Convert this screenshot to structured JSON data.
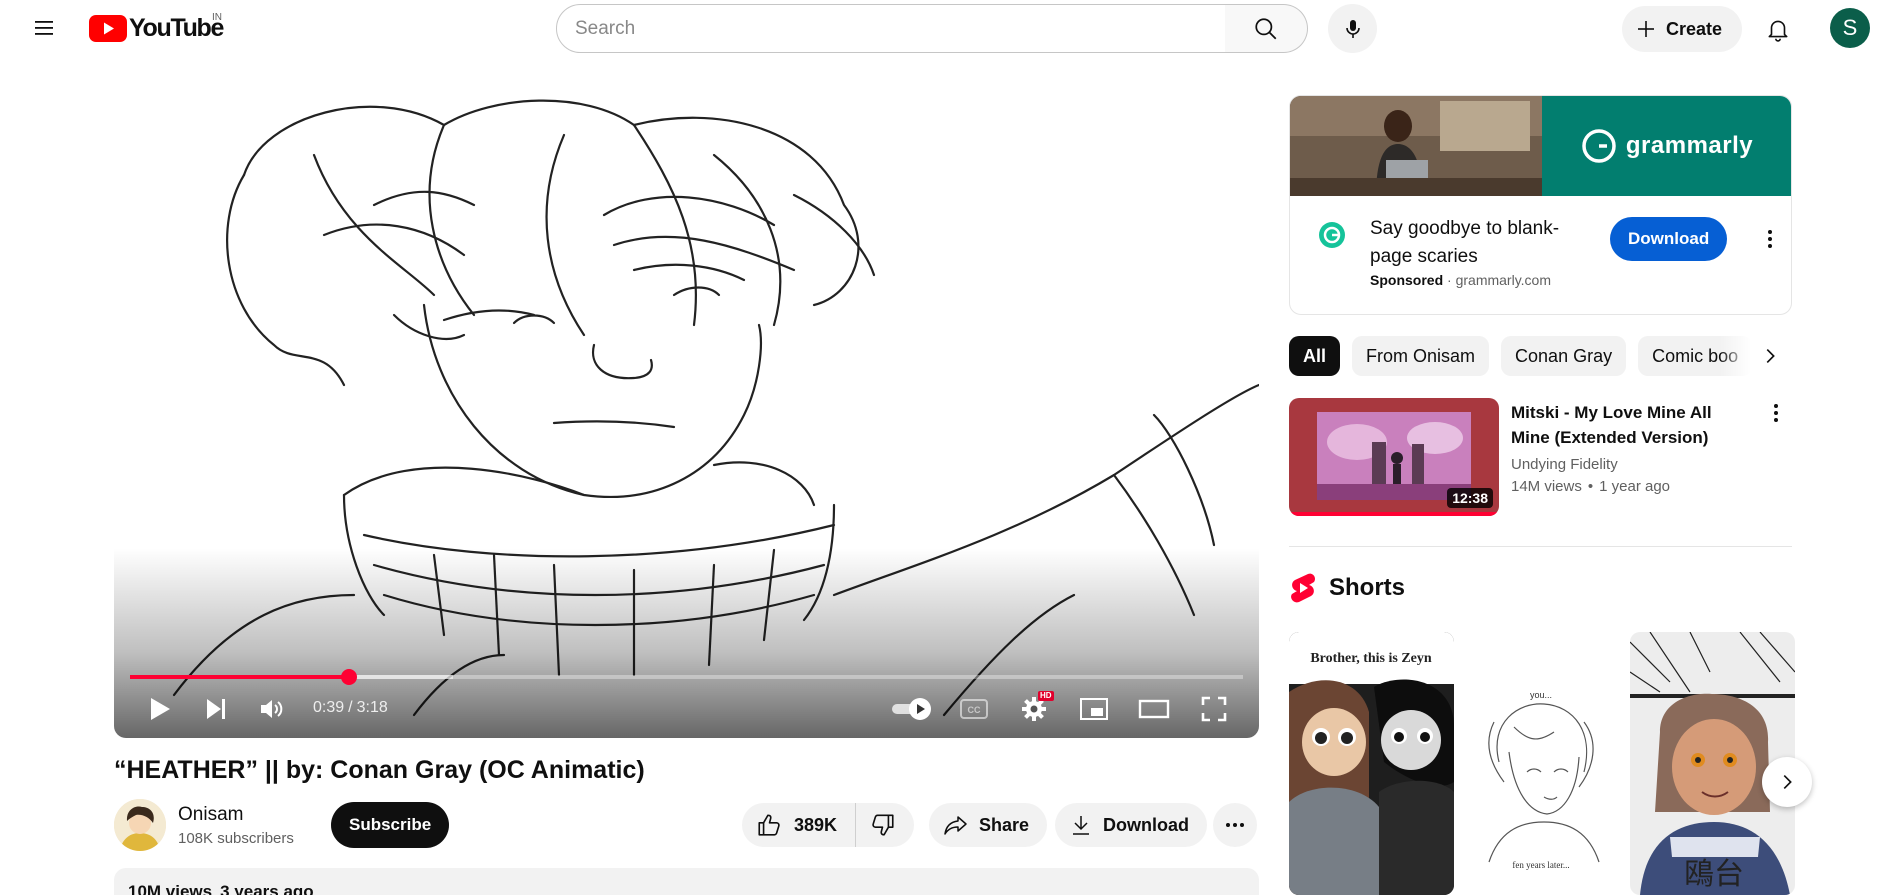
{
  "header": {
    "logo_text": "YouTube",
    "country_code": "IN",
    "search_placeholder": "Search",
    "create_label": "Create",
    "avatar_letter": "S",
    "avatar_color": "#0b5e4a"
  },
  "player": {
    "current_time": "0:39",
    "duration": "3:18",
    "time_separator": "/",
    "progress_fraction": 0.197,
    "buffered_fraction": 0.29,
    "quality_badge": "HD",
    "progress_color": "#ff0033"
  },
  "video": {
    "title": "“HEATHER” || by: Conan Gray (OC Animatic)",
    "channel_name": "Onisam",
    "subscribers": "108K subscribers",
    "subscribe_label": "Subscribe",
    "like_count": "389K",
    "share_label": "Share",
    "download_label": "Download",
    "views": "10M views",
    "age": "3 years ago"
  },
  "ad": {
    "brand": "grammarly",
    "headline": "Say goodbye to blank-page scaries",
    "sponsored_label": "Sponsored",
    "domain": "grammarly.com",
    "cta_label": "Download",
    "brand_color": "#027e6f",
    "cta_color": "#065fd4"
  },
  "chips": [
    {
      "label": "All",
      "active": true
    },
    {
      "label": "From Onisam",
      "active": false
    },
    {
      "label": "Conan Gray",
      "active": false
    },
    {
      "label": "Comic boo",
      "active": false
    }
  ],
  "recommendation": {
    "title": "Mitski - My Love Mine All Mine (Extended Version)",
    "channel": "Undying Fidelity",
    "views": "14M views",
    "age": "1 year ago",
    "duration": "12:38"
  },
  "shorts": {
    "label": "Shorts",
    "items": [
      {
        "caption": "Brother, this is Zeyn"
      },
      {
        "caption": "you..."
      },
      {
        "caption": "鴎台"
      }
    ]
  }
}
